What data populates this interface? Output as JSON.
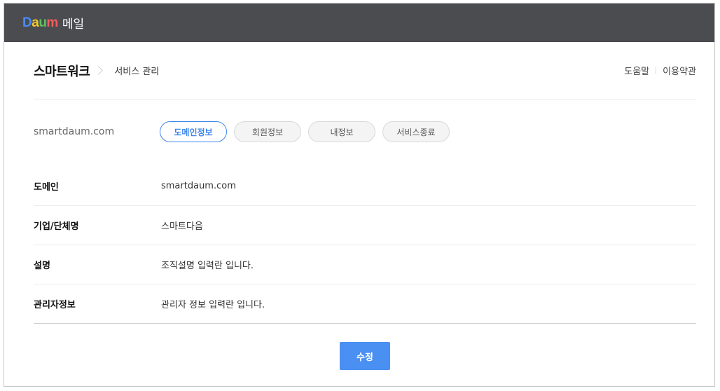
{
  "topbar": {
    "logo_letters": [
      "D",
      "a",
      "u",
      "m"
    ],
    "service_name": "메일"
  },
  "header": {
    "brand": "스마트워크",
    "breadcrumb": "서비스 관리",
    "help_link": "도움말",
    "terms_link": "이용약관"
  },
  "domain": {
    "name": "smartdaum.com"
  },
  "tabs": [
    {
      "label": "도메인정보",
      "active": true
    },
    {
      "label": "회원정보",
      "active": false
    },
    {
      "label": "내정보",
      "active": false
    },
    {
      "label": "서비스종료",
      "active": false
    }
  ],
  "info_rows": [
    {
      "label": "도메인",
      "value": "smartdaum.com"
    },
    {
      "label": "기업/단체명",
      "value": "스마트다음"
    },
    {
      "label": "설명",
      "value": "조직설명 입력란 입니다."
    },
    {
      "label": "관리자정보",
      "value": "관리자 정보 입력란 입니다."
    }
  ],
  "actions": {
    "edit_label": "수정"
  },
  "colors": {
    "topbar_bg": "#4b4c50",
    "accent": "#3f86ee",
    "button_bg": "#4a8ff2"
  }
}
